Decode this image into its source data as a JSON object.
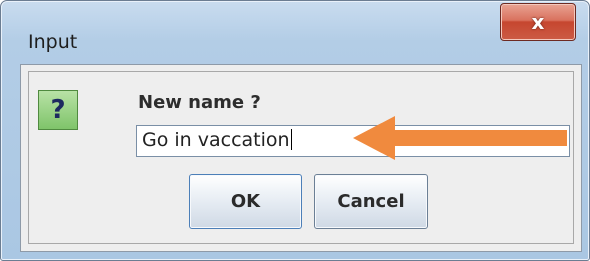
{
  "window": {
    "title": "Input",
    "close_label": "x"
  },
  "dialog": {
    "icon_glyph": "?",
    "prompt": "New name ?",
    "input_value": "Go in vaccation",
    "ok_label": "OK",
    "cancel_label": "Cancel"
  },
  "icons": {
    "question": "question-icon",
    "close": "close-icon",
    "annotation": "arrow-left-annotation"
  },
  "colors": {
    "annotation_arrow": "#f08a3e",
    "icon_green": "#7fc46a"
  }
}
